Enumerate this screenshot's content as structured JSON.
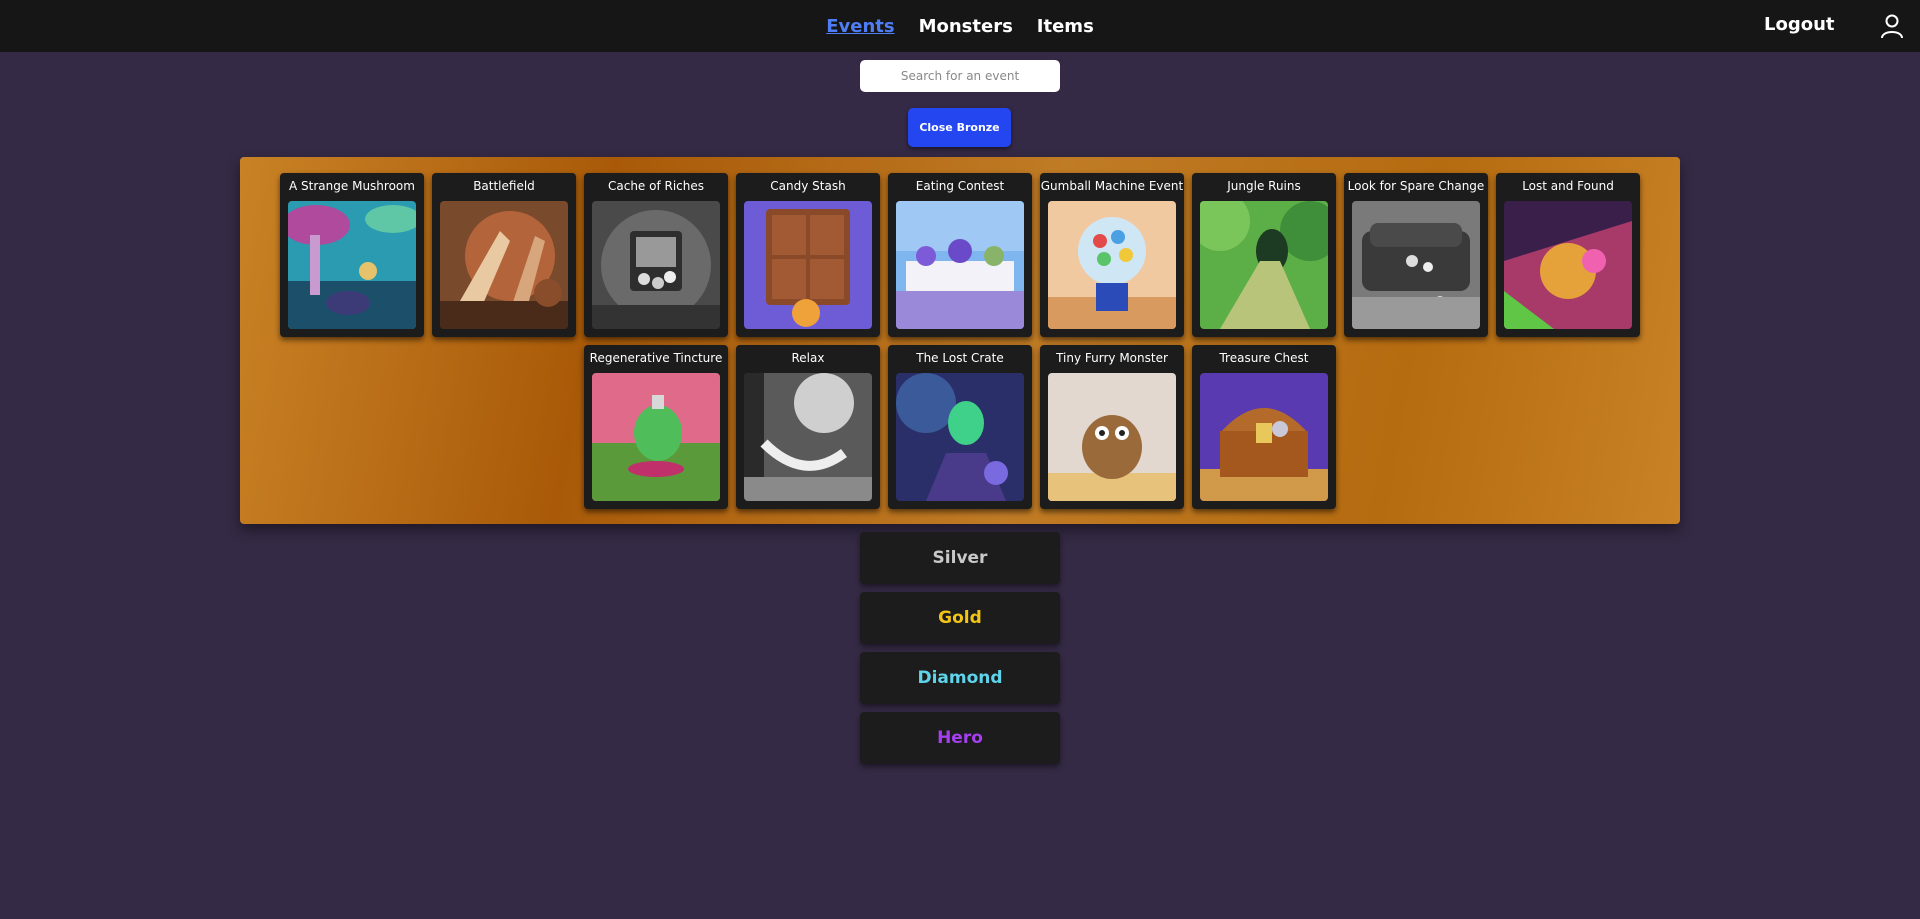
{
  "nav": {
    "links": [
      {
        "label": "Events",
        "active": true
      },
      {
        "label": "Monsters",
        "active": false
      },
      {
        "label": "Items",
        "active": false
      }
    ],
    "logout_label": "Logout",
    "user_icon": "user-icon"
  },
  "search": {
    "placeholder": "Search for an event",
    "value": ""
  },
  "bronze": {
    "close_label": "Close Bronze",
    "accent": "#c98226",
    "events": [
      {
        "title": "A Strange Mushroom"
      },
      {
        "title": "Battlefield"
      },
      {
        "title": "Cache of Riches"
      },
      {
        "title": "Candy Stash"
      },
      {
        "title": "Eating Contest"
      },
      {
        "title": "Gumball Machine Event"
      },
      {
        "title": "Jungle Ruins"
      },
      {
        "title": "Look for Spare Change"
      },
      {
        "title": "Lost and Found"
      },
      {
        "title": "Regenerative Tincture"
      },
      {
        "title": "Relax"
      },
      {
        "title": "The Lost Crate"
      },
      {
        "title": "Tiny Furry Monster"
      },
      {
        "title": "Treasure Chest"
      }
    ]
  },
  "tiers": [
    {
      "label": "Silver",
      "color": "#c9c9c9"
    },
    {
      "label": "Gold",
      "color": "#f2c417"
    },
    {
      "label": "Diamond",
      "color": "#5fd3ea"
    },
    {
      "label": "Hero",
      "color": "#a53ff0"
    }
  ]
}
